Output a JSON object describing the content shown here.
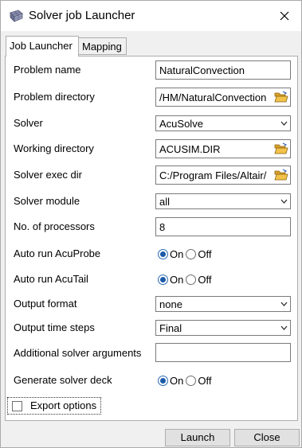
{
  "window": {
    "title": "Solver job Launcher",
    "icons": {
      "app": "grid-app-icon",
      "close": "close-icon"
    }
  },
  "tabs": [
    {
      "label": "Job Launcher",
      "active": true
    },
    {
      "label": "Mapping",
      "active": false
    }
  ],
  "form": {
    "problem_name": {
      "label": "Problem name",
      "value": "NaturalConvection"
    },
    "problem_directory": {
      "label": "Problem directory",
      "value": "/HM/NaturalConvection"
    },
    "solver": {
      "label": "Solver",
      "value": "AcuSolve"
    },
    "working_directory": {
      "label": "Working directory",
      "value": "ACUSIM.DIR"
    },
    "solver_exec_dir": {
      "label": "Solver exec dir",
      "value": "C:/Program Files/Altair/"
    },
    "solver_module": {
      "label": "Solver module",
      "value": "all"
    },
    "num_processors": {
      "label": "No. of processors",
      "value": "8"
    },
    "auto_run_acuprobe": {
      "label": "Auto run AcuProbe",
      "selected": "On"
    },
    "auto_run_acutail": {
      "label": "Auto run AcuTail",
      "selected": "On"
    },
    "output_format": {
      "label": "Output format",
      "value": "none"
    },
    "output_time_steps": {
      "label": "Output time steps",
      "value": "Final"
    },
    "additional_args": {
      "label": "Additional solver arguments",
      "value": ""
    },
    "generate_solver_deck": {
      "label": "Generate solver deck",
      "selected": "On"
    },
    "radio_options": {
      "on": "On",
      "off": "Off"
    }
  },
  "export_options": {
    "label": "Export options",
    "checked": false
  },
  "buttons": {
    "launch": "Launch",
    "close": "Close"
  }
}
